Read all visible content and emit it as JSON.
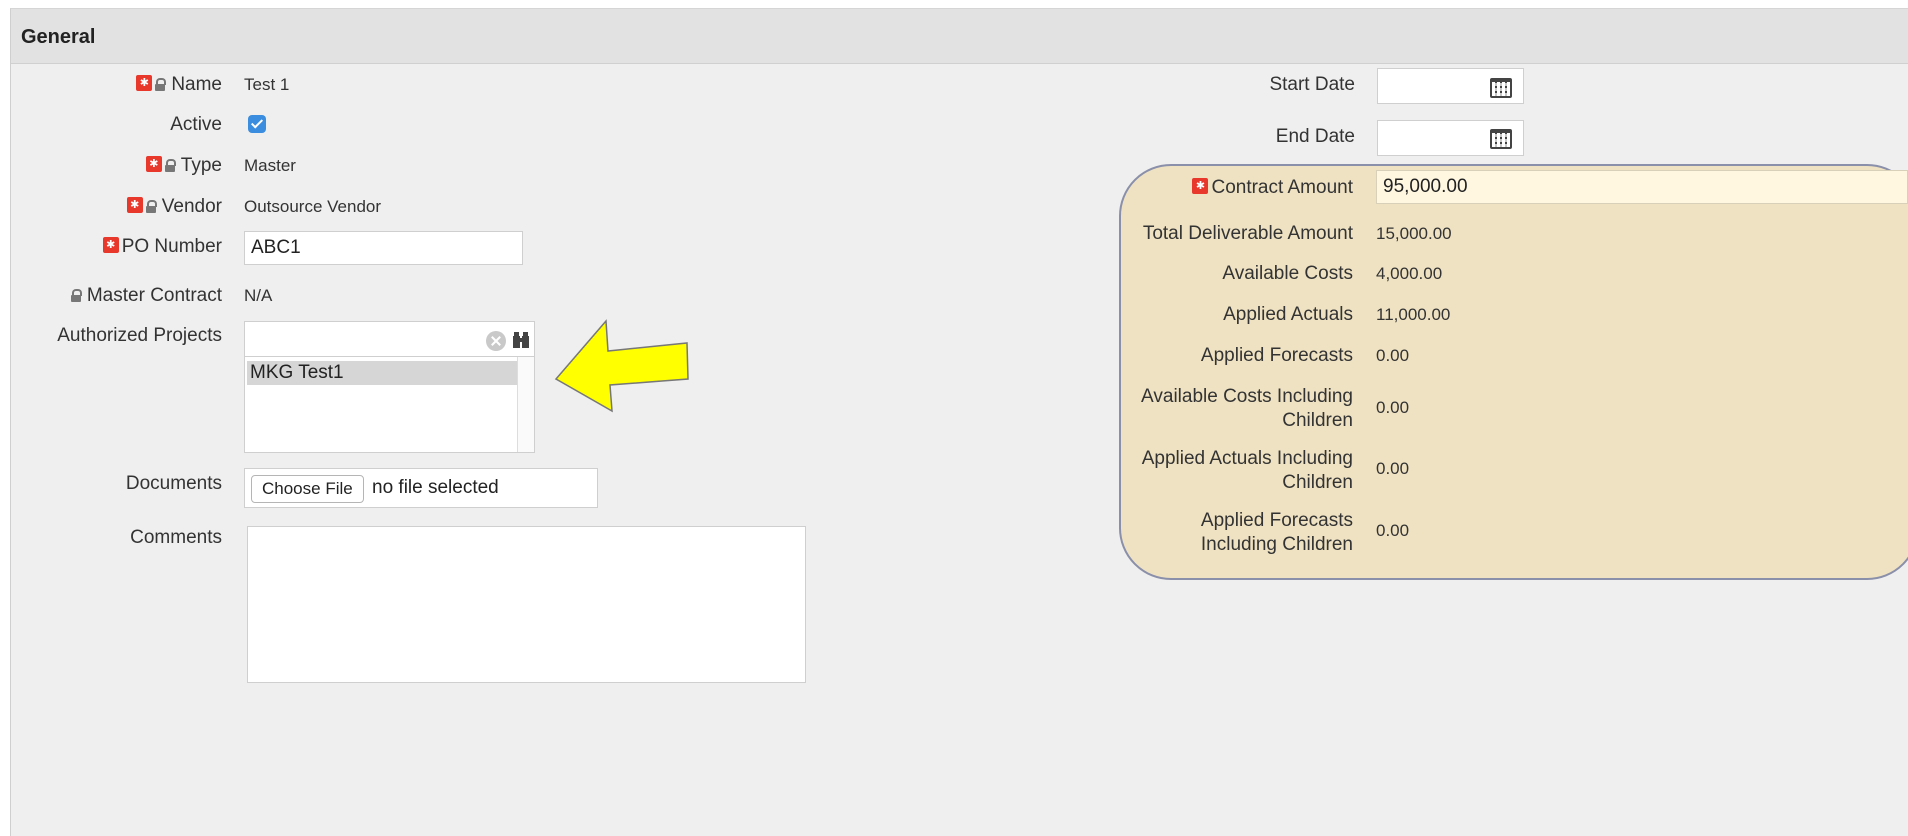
{
  "section": {
    "title": "General"
  },
  "left": {
    "name_label": "Name",
    "name_value": "Test 1",
    "active_label": "Active",
    "active_checked": true,
    "type_label": "Type",
    "type_value": "Master",
    "vendor_label": "Vendor",
    "vendor_value": "Outsource Vendor",
    "po_label": "PO Number",
    "po_value": "ABC1",
    "master_contract_label": "Master Contract",
    "master_contract_value": "N/A",
    "authorized_projects_label": "Authorized Projects",
    "authorized_projects_search": "",
    "authorized_projects_items": [
      "MKG Test1"
    ],
    "documents_label": "Documents",
    "choose_file_label": "Choose File",
    "no_file_text": "no file selected",
    "comments_label": "Comments",
    "comments_value": ""
  },
  "right": {
    "start_date_label": "Start Date",
    "start_date_value": "",
    "end_date_label": "End Date",
    "end_date_value": "",
    "contract_amount_label": "Contract Amount",
    "contract_amount_value": "95,000.00",
    "total_deliverable_label": "Total Deliverable Amount",
    "total_deliverable_value": "15,000.00",
    "available_costs_label": "Available Costs",
    "available_costs_value": "4,000.00",
    "applied_actuals_label": "Applied Actuals",
    "applied_actuals_value": "11,000.00",
    "applied_forecasts_label": "Applied Forecasts",
    "applied_forecasts_value": "0.00",
    "available_costs_children_label": "Available Costs Including Children",
    "available_costs_children_value": "0.00",
    "applied_actuals_children_label": "Applied Actuals Including Children",
    "applied_actuals_children_value": "0.00",
    "applied_forecasts_children_label": "Applied Forecasts Including Children",
    "applied_forecasts_children_value": "0.00"
  },
  "colors": {
    "required_marker": "#e8372b",
    "amount_panel_bg": "#efe2c2",
    "amount_panel_border": "#8a8faa",
    "arrow_fill": "#ffff00",
    "checkbox": "#3b8de0"
  },
  "icons": [
    "required-icon",
    "lock-icon",
    "calendar-icon",
    "clear-icon",
    "binoculars-icon",
    "arrow-annotation"
  ]
}
